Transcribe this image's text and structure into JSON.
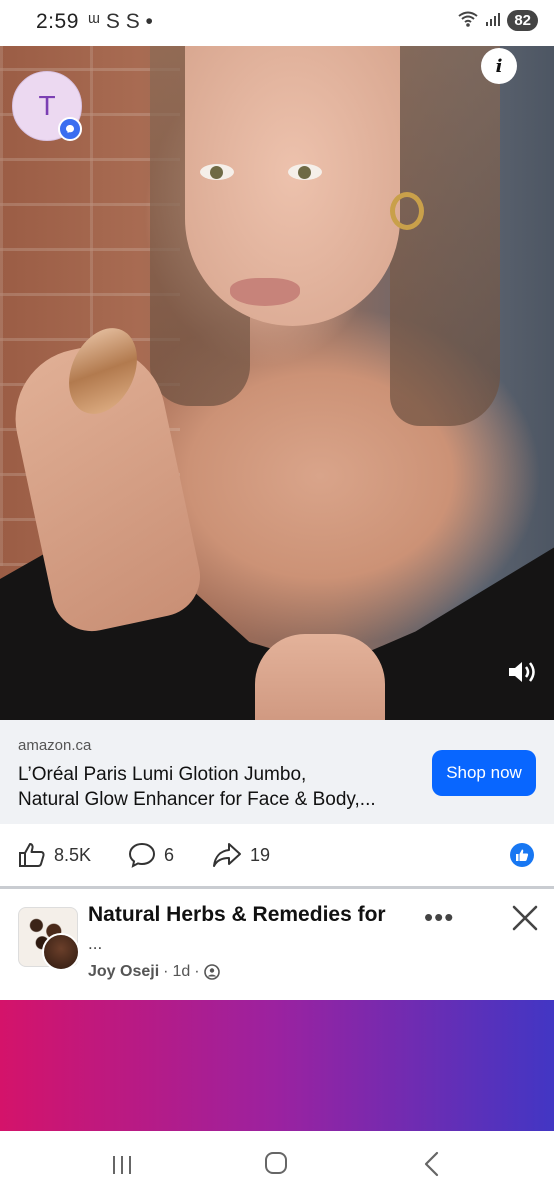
{
  "status_bar": {
    "time": "2:59",
    "extra": "ᵚ S S •",
    "battery": "82"
  },
  "video": {
    "avatar_letter": "T",
    "info_label": "i"
  },
  "ad": {
    "domain": "amazon.ca",
    "title_line1": "L’Oréal Paris Lumi Glotion Jumbo,",
    "title_line2": "Natural Glow Enhancer for Face & Body,...",
    "cta": "Shop now"
  },
  "reactions": {
    "likes": "8.5K",
    "comments": "6",
    "shares": "19"
  },
  "next_post": {
    "title": "Natural Herbs & Remedies for",
    "title_more": "...",
    "author": "Joy Oseji",
    "age": "1d",
    "more_label": "•••"
  },
  "colors": {
    "accent": "#0866ff",
    "reaction_blue": "#1877f2",
    "band_start": "#d4136a",
    "band_end": "#4236c4"
  },
  "icons": [
    "wifi-icon",
    "signal-icon",
    "info-icon",
    "volume-icon",
    "like-icon",
    "comment-icon",
    "share-icon",
    "like-badge-icon",
    "more-icon",
    "close-icon",
    "recent-apps-icon",
    "home-icon",
    "back-icon"
  ]
}
